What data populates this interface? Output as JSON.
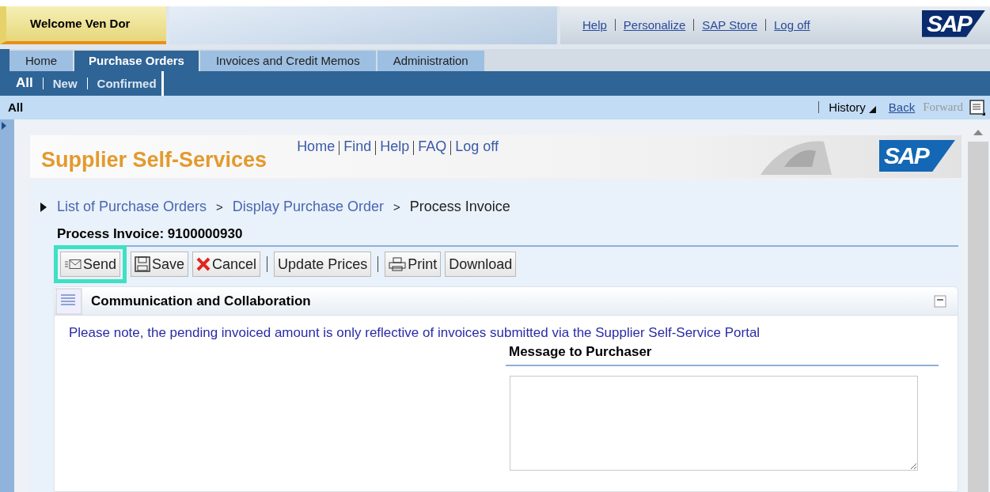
{
  "header": {
    "welcome": "Welcome Ven Dor",
    "links": [
      "Help",
      "Personalize",
      "SAP Store",
      "Log off"
    ],
    "logo": "SAP"
  },
  "tabs": [
    {
      "label": "Home",
      "selected": false
    },
    {
      "label": "Purchase Orders",
      "selected": true
    },
    {
      "label": "Invoices and Credit Memos",
      "selected": false
    },
    {
      "label": "Administration",
      "selected": false
    }
  ],
  "subtabs": [
    {
      "label": "All",
      "selected": true
    },
    {
      "label": "New",
      "selected": false
    },
    {
      "label": "Confirmed",
      "selected": false
    }
  ],
  "page_bar": {
    "title": "All",
    "history": "History",
    "back": "Back",
    "forward": "Forward",
    "forward_disabled": true
  },
  "portal": {
    "title": "Supplier Self-Services",
    "links": [
      "Home",
      "Find",
      "Help",
      "FAQ",
      "Log off"
    ],
    "logo": "SAP"
  },
  "breadcrumb": [
    {
      "label": "List of Purchase Orders",
      "kind": "link"
    },
    {
      "label": "Display Purchase Order",
      "kind": "link",
      "separator": ">"
    },
    {
      "label": "Process Invoice",
      "kind": "current",
      "separator": ">"
    }
  ],
  "form_title": "Process Invoice: 9100000930",
  "toolbar": [
    {
      "label": "Send",
      "kind": "send",
      "highlighted": true,
      "separator_after": false
    },
    {
      "label": "Save",
      "kind": "save",
      "highlighted": false,
      "separator_after": false
    },
    {
      "label": "Cancel",
      "kind": "cancel",
      "highlighted": false,
      "separator_after": true
    },
    {
      "label": "Update Prices",
      "kind": "plain",
      "highlighted": false,
      "separator_after": true
    },
    {
      "label": "Print",
      "kind": "print",
      "highlighted": false,
      "separator_after": false
    },
    {
      "label": "Download",
      "kind": "plain",
      "highlighted": false,
      "separator_after": false
    }
  ],
  "section": {
    "title": "Communication and Collaboration",
    "note": "Please note, the pending invoiced amount is only reflective of invoices submitted via the Supplier Self-Service Portal",
    "message_label": "Message to Purchaser"
  }
}
